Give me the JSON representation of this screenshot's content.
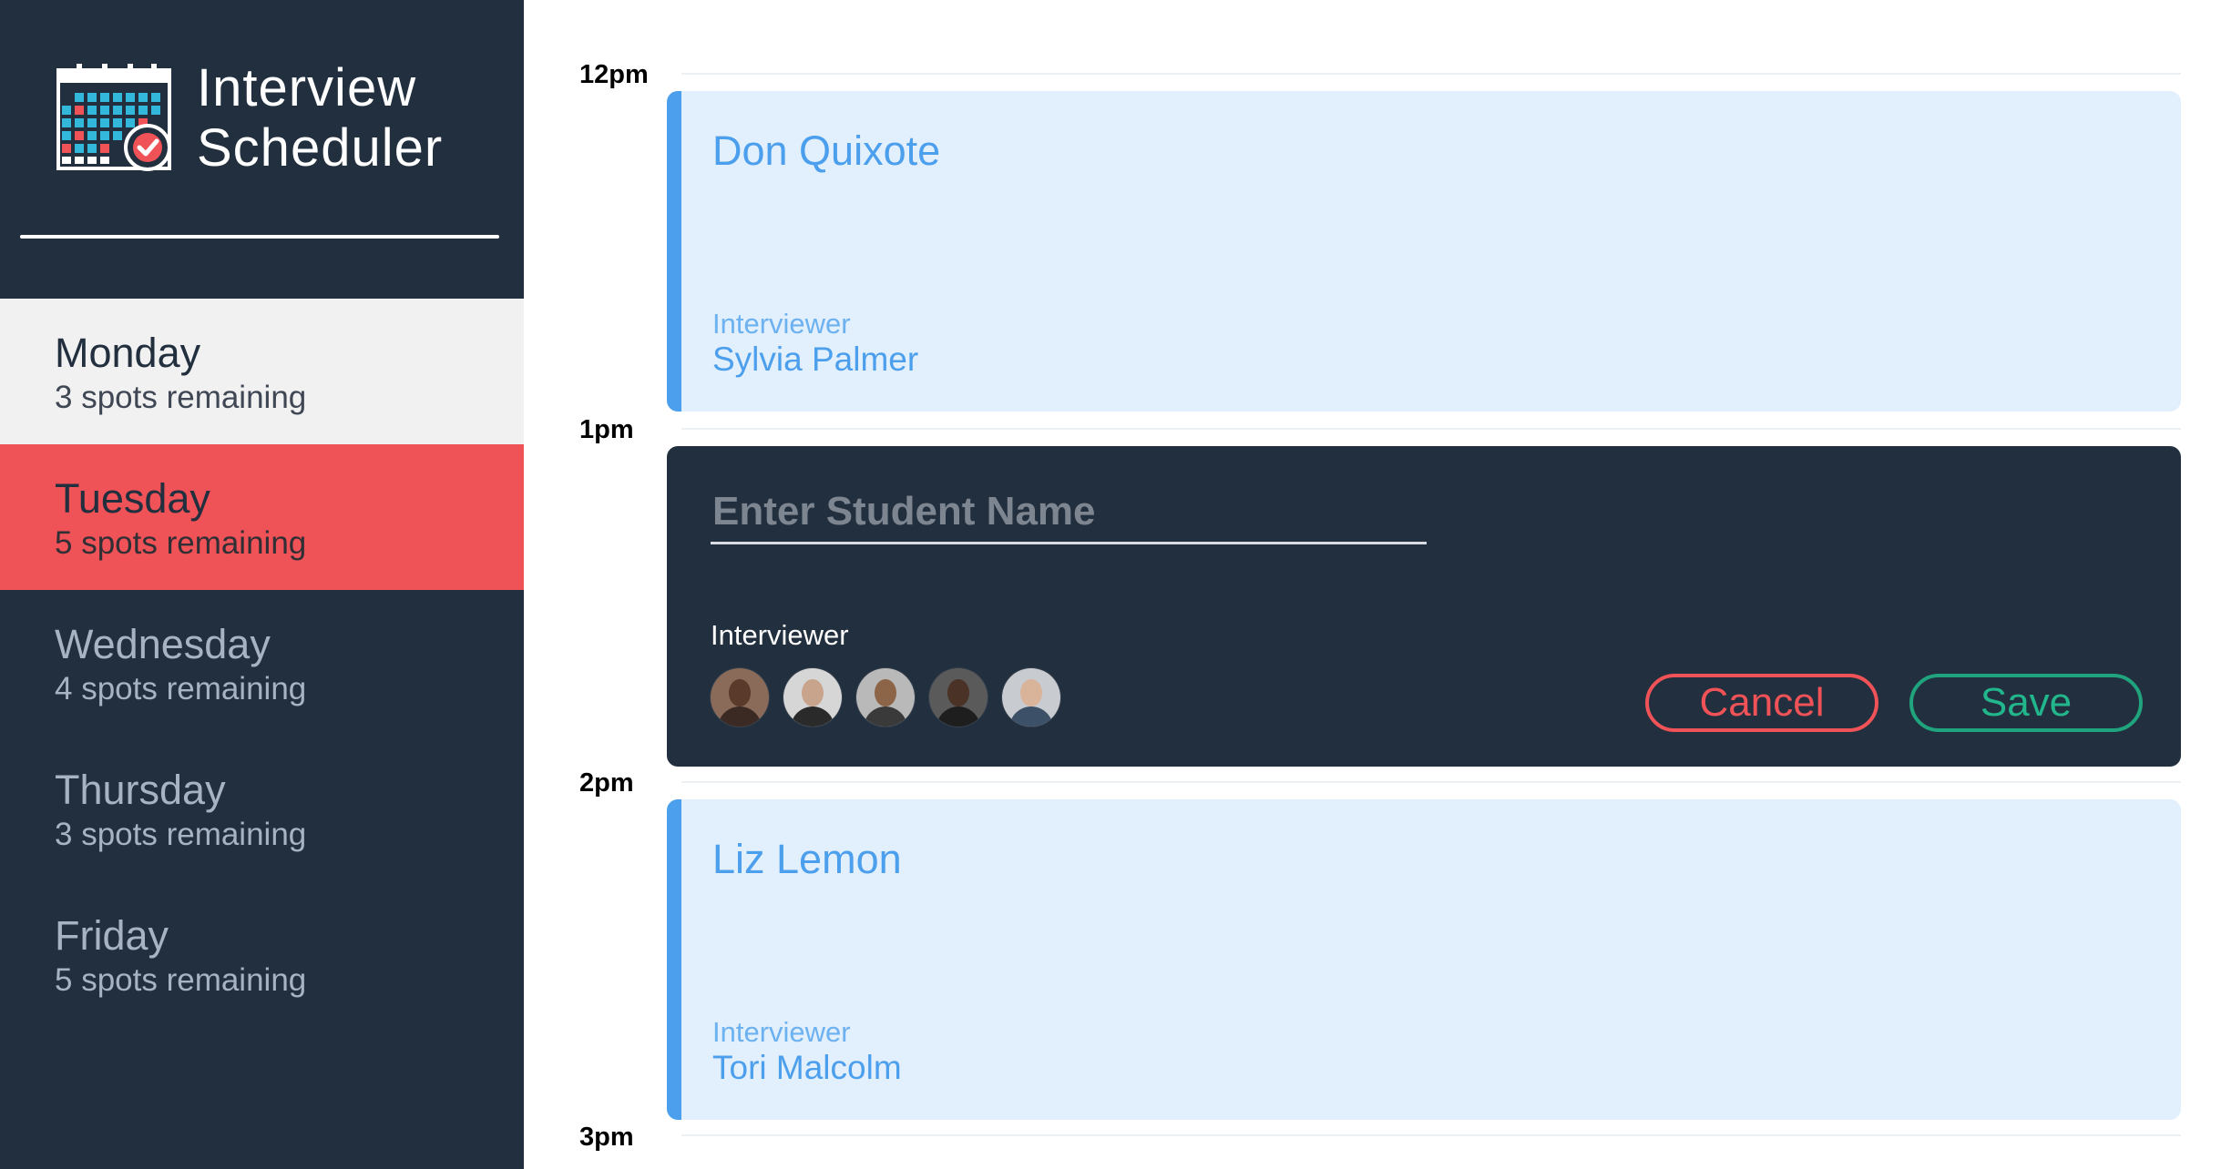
{
  "app": {
    "title_line1": "Interview",
    "title_line2": "Scheduler",
    "logo_icon": "calendar-check-icon"
  },
  "sidebar": {
    "days": [
      {
        "name": "Monday",
        "spots": "3 spots remaining",
        "state": "selected"
      },
      {
        "name": "Tuesday",
        "spots": "5 spots remaining",
        "state": "active"
      },
      {
        "name": "Wednesday",
        "spots": "4 spots remaining",
        "state": "default"
      },
      {
        "name": "Thursday",
        "spots": "3 spots remaining",
        "state": "default"
      },
      {
        "name": "Friday",
        "spots": "5 spots remaining",
        "state": "default"
      }
    ]
  },
  "schedule": {
    "times": [
      "12pm",
      "1pm",
      "2pm",
      "3pm"
    ],
    "appointments": [
      {
        "student": "Don Quixote",
        "interviewer_label": "Interviewer",
        "interviewer": "Sylvia Palmer"
      },
      {
        "student": "Liz Lemon",
        "interviewer_label": "Interviewer",
        "interviewer": "Tori Malcolm"
      }
    ],
    "form": {
      "student_value": "",
      "student_placeholder": "Enter Student Name",
      "interviewer_label": "Interviewer",
      "interviewer_avatars": [
        "avatar-1",
        "avatar-2",
        "avatar-3",
        "avatar-4",
        "avatar-5"
      ],
      "cancel_label": "Cancel",
      "save_label": "Save"
    }
  },
  "colors": {
    "sidebar_bg": "#222f3e",
    "accent_red": "#ef5257",
    "accent_blue": "#4b9fec",
    "card_bg": "#e2effd",
    "save_green": "#22b68c"
  }
}
